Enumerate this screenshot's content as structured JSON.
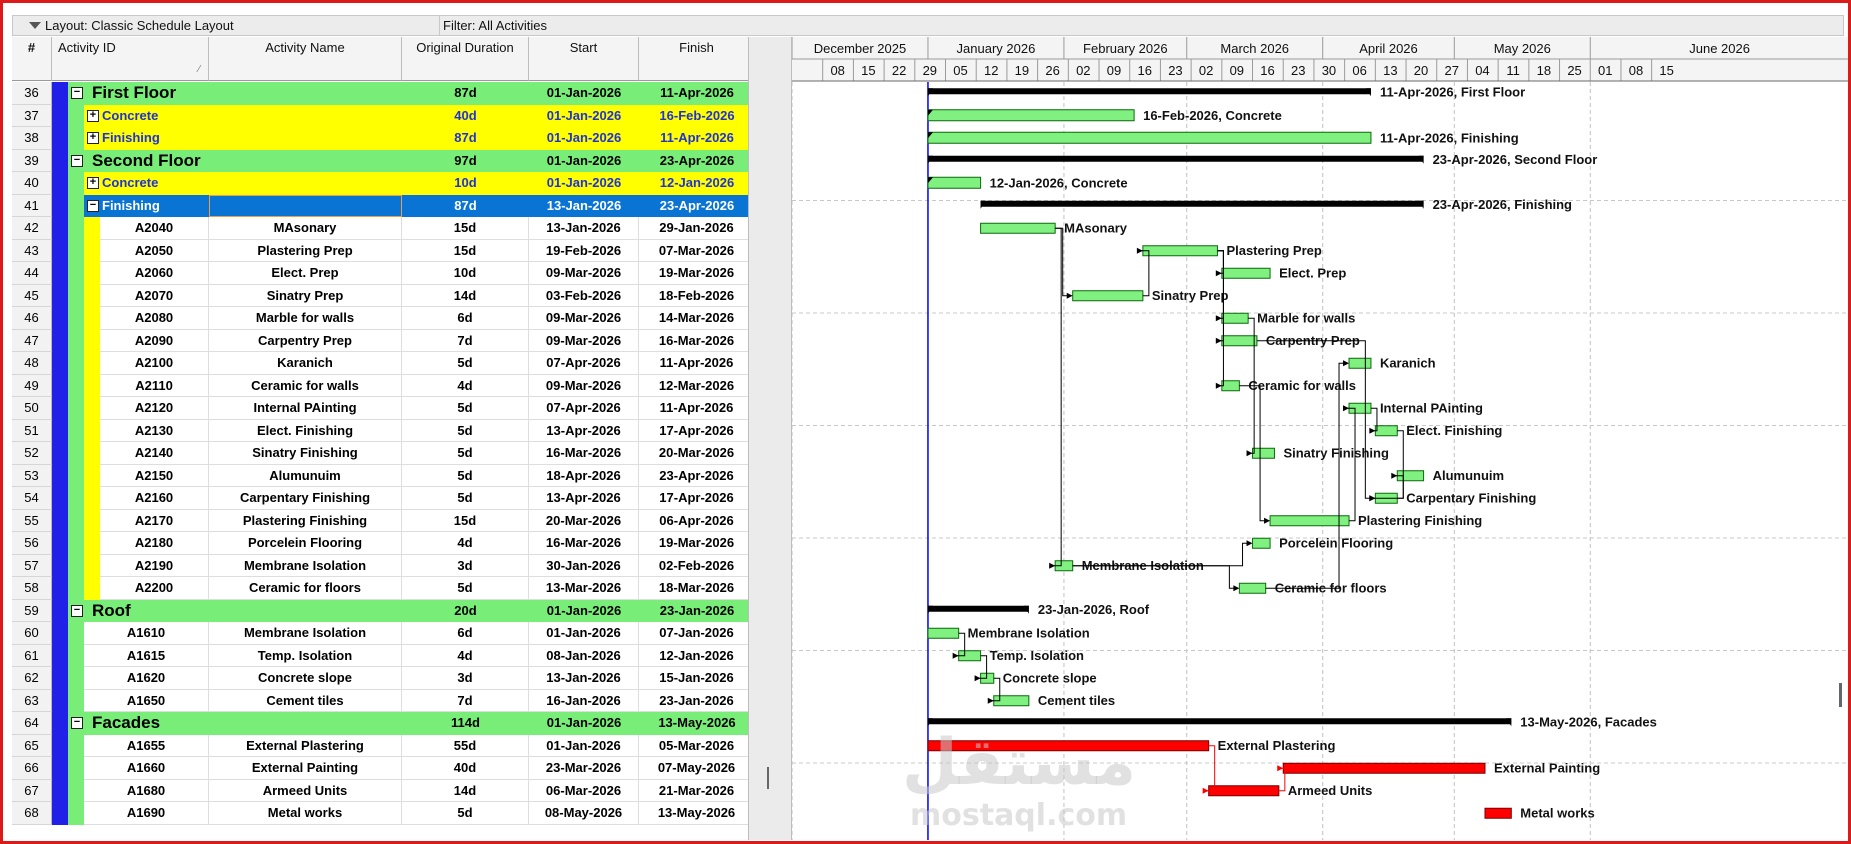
{
  "toolbar": {
    "layout_label": "Layout: Classic Schedule Layout",
    "filter_label": "Filter: All Activities"
  },
  "columns": {
    "num": "#",
    "id": "Activity ID",
    "name": "Activity Name",
    "duration": "Original Duration",
    "start": "Start",
    "finish": "Finish"
  },
  "timescale": {
    "months": [
      {
        "label": "December 2025",
        "start": "2025-12-01"
      },
      {
        "label": "January 2026",
        "start": "2026-01-01"
      },
      {
        "label": "February 2026",
        "start": "2026-02-01"
      },
      {
        "label": "March 2026",
        "start": "2026-03-01"
      },
      {
        "label": "April 2026",
        "start": "2026-04-01"
      },
      {
        "label": "May 2026",
        "start": "2026-05-01"
      },
      {
        "label": "June 2026",
        "start": "2026-06-01"
      }
    ],
    "weeks": [
      "08",
      "15",
      "22",
      "29",
      "05",
      "12",
      "19",
      "26",
      "02",
      "09",
      "16",
      "23",
      "02",
      "09",
      "16",
      "23",
      "30",
      "06",
      "13",
      "20",
      "27",
      "04",
      "11",
      "18",
      "25",
      "01",
      "08",
      "15"
    ],
    "first_week_start": "2025-12-08",
    "range": [
      "2025-12-01",
      "2026-06-22"
    ]
  },
  "rows": [
    {
      "num": "36",
      "type": "wbs1",
      "id": "",
      "name": "First Floor",
      "duration": "87d",
      "start": "01-Jan-2026",
      "finish": "11-Apr-2026",
      "toggle": "−",
      "bar_label": "11-Apr-2026, First Floor"
    },
    {
      "num": "37",
      "type": "wbs2",
      "id": "",
      "name": "Concrete",
      "duration": "40d",
      "start": "01-Jan-2026",
      "finish": "16-Feb-2026",
      "toggle": "+",
      "bar_label": "16-Feb-2026, Concrete"
    },
    {
      "num": "38",
      "type": "wbs2",
      "id": "",
      "name": "Finishing",
      "duration": "87d",
      "start": "01-Jan-2026",
      "finish": "11-Apr-2026",
      "toggle": "+",
      "bar_label": "11-Apr-2026, Finishing"
    },
    {
      "num": "39",
      "type": "wbs1",
      "id": "",
      "name": "Second Floor",
      "duration": "97d",
      "start": "01-Jan-2026",
      "finish": "23-Apr-2026",
      "toggle": "−",
      "bar_label": "23-Apr-2026, Second Floor"
    },
    {
      "num": "40",
      "type": "wbs2",
      "id": "",
      "name": "Concrete",
      "duration": "10d",
      "start": "01-Jan-2026",
      "finish": "12-Jan-2026",
      "toggle": "+",
      "bar_label": "12-Jan-2026, Concrete"
    },
    {
      "num": "41",
      "type": "sel",
      "id": "",
      "name": "Finishing",
      "duration": "87d",
      "start": "13-Jan-2026",
      "finish": "23-Apr-2026",
      "toggle": "−",
      "bar_label": "23-Apr-2026, Finishing"
    },
    {
      "num": "42",
      "type": "act",
      "id": "A2040",
      "name": "MAsonary",
      "duration": "15d",
      "start": "13-Jan-2026",
      "finish": "29-Jan-2026"
    },
    {
      "num": "43",
      "type": "act",
      "id": "A2050",
      "name": "Plastering Prep",
      "duration": "15d",
      "start": "19-Feb-2026",
      "finish": "07-Mar-2026"
    },
    {
      "num": "44",
      "type": "act",
      "id": "A2060",
      "name": "Elect. Prep",
      "duration": "10d",
      "start": "09-Mar-2026",
      "finish": "19-Mar-2026"
    },
    {
      "num": "45",
      "type": "act",
      "id": "A2070",
      "name": "Sinatry Prep",
      "duration": "14d",
      "start": "03-Feb-2026",
      "finish": "18-Feb-2026"
    },
    {
      "num": "46",
      "type": "act",
      "id": "A2080",
      "name": "Marble for walls",
      "duration": "6d",
      "start": "09-Mar-2026",
      "finish": "14-Mar-2026"
    },
    {
      "num": "47",
      "type": "act",
      "id": "A2090",
      "name": "Carpentry Prep",
      "duration": "7d",
      "start": "09-Mar-2026",
      "finish": "16-Mar-2026"
    },
    {
      "num": "48",
      "type": "act",
      "id": "A2100",
      "name": "Karanich",
      "duration": "5d",
      "start": "07-Apr-2026",
      "finish": "11-Apr-2026"
    },
    {
      "num": "49",
      "type": "act",
      "id": "A2110",
      "name": "Ceramic for walls",
      "duration": "4d",
      "start": "09-Mar-2026",
      "finish": "12-Mar-2026"
    },
    {
      "num": "50",
      "type": "act",
      "id": "A2120",
      "name": "Internal PAinting",
      "duration": "5d",
      "start": "07-Apr-2026",
      "finish": "11-Apr-2026"
    },
    {
      "num": "51",
      "type": "act",
      "id": "A2130",
      "name": "Elect. Finishing",
      "duration": "5d",
      "start": "13-Apr-2026",
      "finish": "17-Apr-2026"
    },
    {
      "num": "52",
      "type": "act",
      "id": "A2140",
      "name": "Sinatry Finishing",
      "duration": "5d",
      "start": "16-Mar-2026",
      "finish": "20-Mar-2026"
    },
    {
      "num": "53",
      "type": "act",
      "id": "A2150",
      "name": "Alumunuim",
      "duration": "5d",
      "start": "18-Apr-2026",
      "finish": "23-Apr-2026"
    },
    {
      "num": "54",
      "type": "act",
      "id": "A2160",
      "name": "Carpentary Finishing",
      "duration": "5d",
      "start": "13-Apr-2026",
      "finish": "17-Apr-2026"
    },
    {
      "num": "55",
      "type": "act",
      "id": "A2170",
      "name": "Plastering Finishing",
      "duration": "15d",
      "start": "20-Mar-2026",
      "finish": "06-Apr-2026"
    },
    {
      "num": "56",
      "type": "act",
      "id": "A2180",
      "name": "Porcelein Flooring",
      "duration": "4d",
      "start": "16-Mar-2026",
      "finish": "19-Mar-2026"
    },
    {
      "num": "57",
      "type": "act",
      "id": "A2190",
      "name": "Membrane Isolation",
      "duration": "3d",
      "start": "30-Jan-2026",
      "finish": "02-Feb-2026"
    },
    {
      "num": "58",
      "type": "act",
      "id": "A2200",
      "name": "Ceramic for floors",
      "duration": "5d",
      "start": "13-Mar-2026",
      "finish": "18-Mar-2026"
    },
    {
      "num": "59",
      "type": "wbs1",
      "id": "",
      "name": "Roof",
      "duration": "20d",
      "start": "01-Jan-2026",
      "finish": "23-Jan-2026",
      "toggle": "−",
      "bar_label": "23-Jan-2026, Roof"
    },
    {
      "num": "60",
      "type": "act2",
      "id": "A1610",
      "name": "Membrane Isolation",
      "duration": "6d",
      "start": "01-Jan-2026",
      "finish": "07-Jan-2026"
    },
    {
      "num": "61",
      "type": "act2",
      "id": "A1615",
      "name": "Temp. Isolation",
      "duration": "4d",
      "start": "08-Jan-2026",
      "finish": "12-Jan-2026"
    },
    {
      "num": "62",
      "type": "act2",
      "id": "A1620",
      "name": "Concrete slope",
      "duration": "3d",
      "start": "13-Jan-2026",
      "finish": "15-Jan-2026"
    },
    {
      "num": "63",
      "type": "act2",
      "id": "A1650",
      "name": "Cement tiles",
      "duration": "7d",
      "start": "16-Jan-2026",
      "finish": "23-Jan-2026"
    },
    {
      "num": "64",
      "type": "wbs1",
      "id": "",
      "name": "Facades",
      "duration": "114d",
      "start": "01-Jan-2026",
      "finish": "13-May-2026",
      "toggle": "−",
      "bar_label": "13-May-2026, Facades"
    },
    {
      "num": "65",
      "type": "act2",
      "id": "A1655",
      "name": "External Plastering",
      "duration": "55d",
      "start": "01-Jan-2026",
      "finish": "05-Mar-2026",
      "critical": true
    },
    {
      "num": "66",
      "type": "act2",
      "id": "A1660",
      "name": "External Painting",
      "duration": "40d",
      "start": "23-Mar-2026",
      "finish": "07-May-2026",
      "critical": true
    },
    {
      "num": "67",
      "type": "act2",
      "id": "A1680",
      "name": "Armeed Units",
      "duration": "14d",
      "start": "06-Mar-2026",
      "finish": "21-Mar-2026",
      "critical": true
    },
    {
      "num": "68",
      "type": "act2",
      "id": "A1690",
      "name": "Metal works",
      "duration": "5d",
      "start": "08-May-2026",
      "finish": "13-May-2026",
      "critical": true
    }
  ],
  "watermark": {
    "arabic": "مستقل",
    "latin": "mostaql.com"
  },
  "colors": {
    "wbs1": "#78ee78",
    "wbs2": "#ffff00",
    "selected": "#0a74d4",
    "bar_green": "#80f080",
    "bar_critical": "#ff0000",
    "summary_bar": "#000000",
    "data_date": "#0000ff",
    "frame": "#dc1a1a"
  }
}
